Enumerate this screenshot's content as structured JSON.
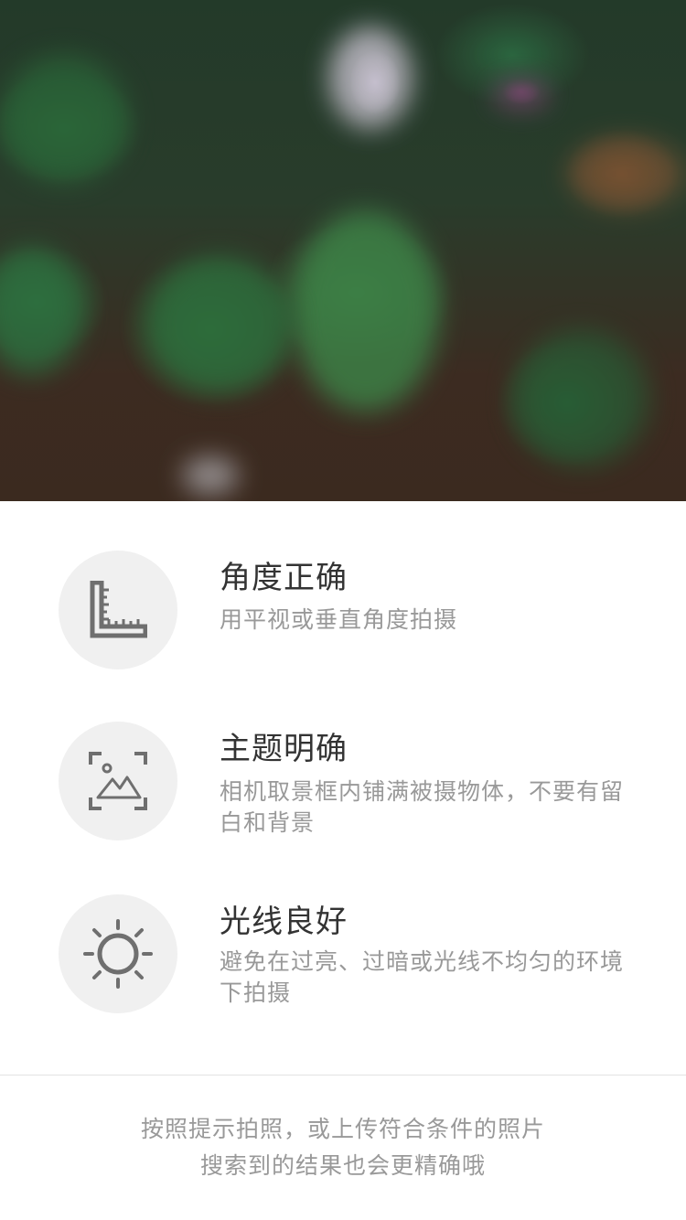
{
  "tips": [
    {
      "icon": "ruler-icon",
      "title": "角度正确",
      "desc": "用平视或垂直角度拍摄"
    },
    {
      "icon": "frame-image-icon",
      "title": "主题明确",
      "desc": "相机取景框内铺满被摄物体，不要有留白和背景"
    },
    {
      "icon": "sun-icon",
      "title": "光线良好",
      "desc": "避免在过亮、过暗或光线不均匀的环境下拍摄"
    }
  ],
  "footer": {
    "line1": "按照提示拍照，或上传符合条件的照片",
    "line2": "搜索到的结果也会更精确哦"
  },
  "colors": {
    "icon": "#6f6f6f",
    "icon_bg": "#f0f0f0",
    "title": "#333333",
    "desc": "#999999"
  }
}
